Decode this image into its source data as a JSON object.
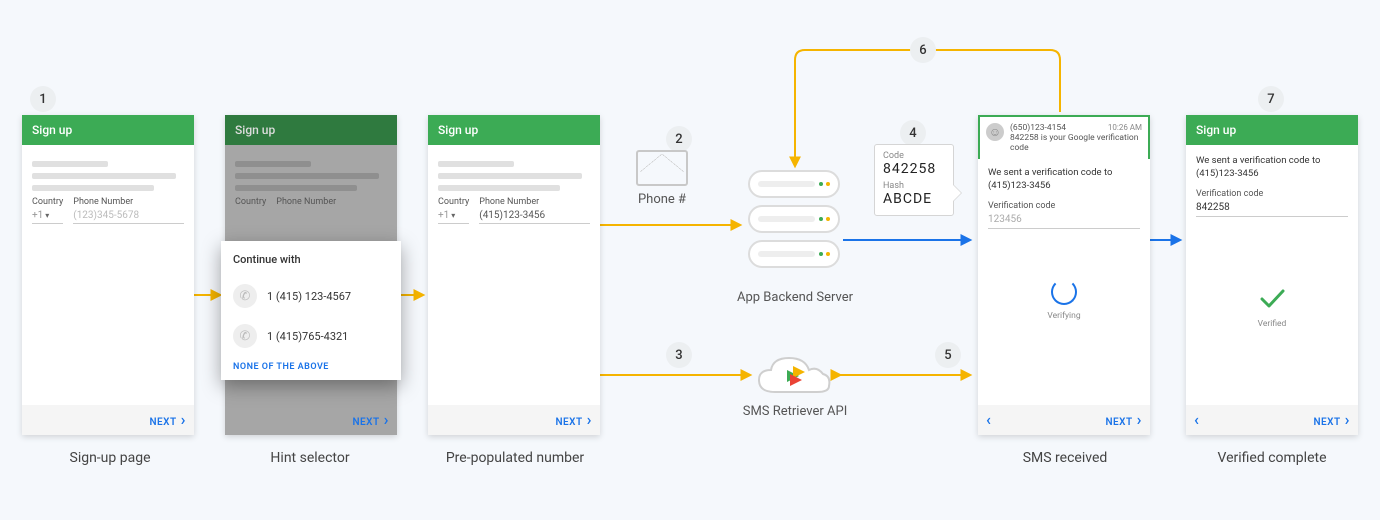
{
  "steps": {
    "s1": "1",
    "s2": "2",
    "s3": "3",
    "s4": "4",
    "s5": "5",
    "s6": "6",
    "s7": "7"
  },
  "phone1": {
    "title": "Sign up",
    "country_label": "Country",
    "phone_label": "Phone Number",
    "country_value": "+1",
    "phone_placeholder": "(123)345-5678",
    "next": "NEXT",
    "caption": "Sign-up page"
  },
  "phone2": {
    "title": "Sign up",
    "country_label": "Country",
    "phone_label": "Phone Number",
    "dialog_title": "Continue with",
    "option1": "1 (415) 123-4567",
    "option2": "1 (415)765-4321",
    "none": "NONE OF THE ABOVE",
    "next": "NEXT",
    "caption": "Hint selector"
  },
  "phone3": {
    "title": "Sign up",
    "country_label": "Country",
    "phone_label": "Phone Number",
    "country_value": "+1",
    "phone_value": "(415)123-3456",
    "next": "NEXT",
    "caption": "Pre-populated number"
  },
  "mid": {
    "envelope_caption": "Phone #",
    "server_caption": "App Backend Server",
    "api_caption": "SMS Retriever API"
  },
  "code_bubble": {
    "code_label": "Code",
    "code_value": "842258",
    "hash_label": "Hash",
    "hash_value": "ABCDE"
  },
  "phone4": {
    "sms_from": "(650)123-4154",
    "sms_time": "10:26 AM",
    "sms_body": "842258 is your Google verification code",
    "sent_line1": "We sent a verification code to",
    "sent_line2": "(415)123-3456",
    "verif_label": "Verification code",
    "verif_value": "123456",
    "verifying": "Verifying",
    "next": "NEXT",
    "caption": "SMS received"
  },
  "phone5": {
    "title": "Sign up",
    "sent_line1": "We sent a verification code to",
    "sent_line2": "(415)123-3456",
    "verif_label": "Verification code",
    "verif_value": "842258",
    "verified": "Verified",
    "next": "NEXT",
    "caption": "Verified complete"
  }
}
